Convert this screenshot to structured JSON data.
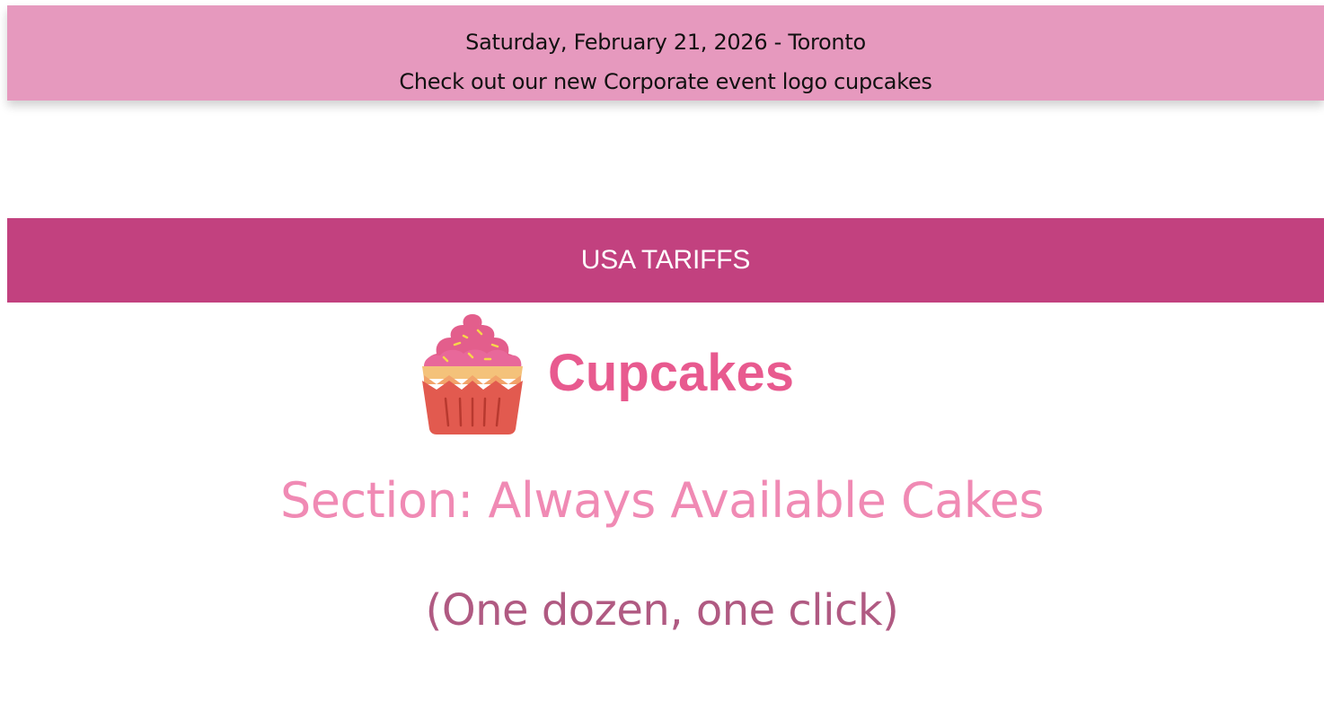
{
  "top_banner": {
    "date_location": "Saturday, February 21, 2026 - Toronto",
    "promo": "Check out our new Corporate event logo cupcakes",
    "background_color": "#e699be"
  },
  "tariff_bar": {
    "label": "USA TARIFFS",
    "background_color": "#c2417f"
  },
  "brand": {
    "logo_icon": "cupcake-icon",
    "name": "Cupcakes",
    "color": "#e85a8f"
  },
  "section": {
    "title": "Section: Always Available Cakes",
    "subtitle": "(One dozen, one click)"
  }
}
